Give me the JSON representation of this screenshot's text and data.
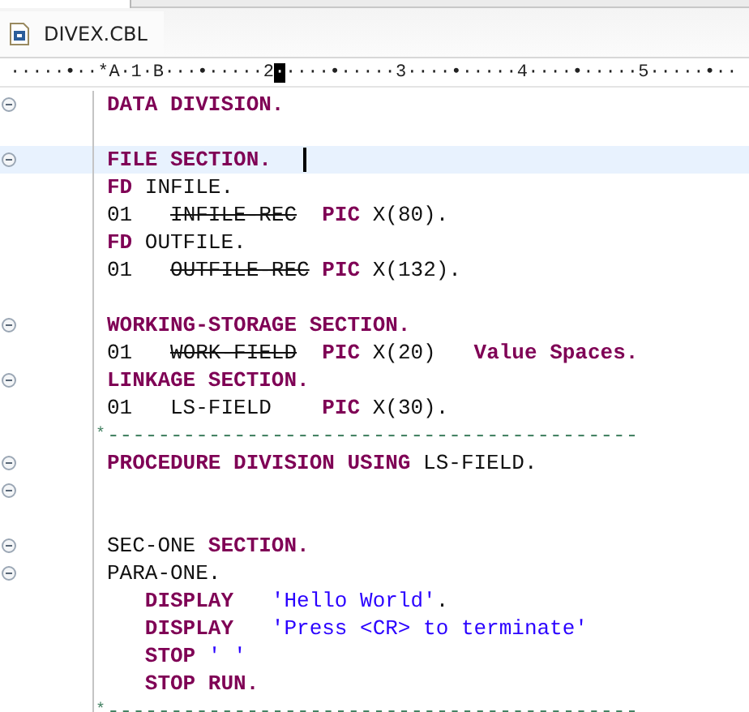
{
  "tab": {
    "title": "DIVEX.CBL"
  },
  "ruler": {
    "before": "·····•··*A·1·B···•·····2",
    "cursor": "·",
    "after": "····•·····3····•·····4····•·····5·····•··"
  },
  "lines": [
    {
      "kind": "code",
      "fold": true,
      "tokens": [
        {
          "kind": "keyword",
          "text": "DATA DIVISION."
        }
      ]
    },
    {
      "kind": "blank"
    },
    {
      "kind": "code",
      "fold": true,
      "current": true,
      "tokens": [
        {
          "kind": "keyword",
          "text": "FILE SECTION."
        }
      ]
    },
    {
      "kind": "code",
      "tokens": [
        {
          "kind": "keyword",
          "text": "FD "
        },
        {
          "kind": "plain",
          "text": "INFILE."
        }
      ]
    },
    {
      "kind": "code",
      "tokens": [
        {
          "kind": "plain",
          "text": "01   "
        },
        {
          "kind": "deleted",
          "text": "INFILE-REC"
        },
        {
          "kind": "keyword",
          "text": "  PIC "
        },
        {
          "kind": "plain",
          "text": "X(80)."
        }
      ]
    },
    {
      "kind": "code",
      "tokens": [
        {
          "kind": "keyword",
          "text": "FD "
        },
        {
          "kind": "plain",
          "text": "OUTFILE."
        }
      ]
    },
    {
      "kind": "code",
      "tokens": [
        {
          "kind": "plain",
          "text": "01   "
        },
        {
          "kind": "deleted",
          "text": "OUTFILE-REC"
        },
        {
          "kind": "keyword",
          "text": " PIC "
        },
        {
          "kind": "plain",
          "text": "X(132)."
        }
      ]
    },
    {
      "kind": "blank"
    },
    {
      "kind": "code",
      "fold": true,
      "tokens": [
        {
          "kind": "keyword",
          "text": "WORKING-STORAGE SECTION."
        }
      ]
    },
    {
      "kind": "code",
      "tokens": [
        {
          "kind": "plain",
          "text": "01   "
        },
        {
          "kind": "deleted",
          "text": "WORK-FIELD"
        },
        {
          "kind": "keyword",
          "text": "  PIC "
        },
        {
          "kind": "plain",
          "text": "X(20)   "
        },
        {
          "kind": "keyword",
          "text": "Value Spaces."
        }
      ]
    },
    {
      "kind": "code",
      "fold": true,
      "tokens": [
        {
          "kind": "keyword",
          "text": "LINKAGE SECTION."
        }
      ]
    },
    {
      "kind": "code",
      "tokens": [
        {
          "kind": "plain",
          "text": "01   LS-FIELD    "
        },
        {
          "kind": "keyword",
          "text": "PIC "
        },
        {
          "kind": "plain",
          "text": "X(30)."
        }
      ]
    },
    {
      "kind": "comment",
      "indicator": "*",
      "tokens": [
        {
          "kind": "comment",
          "text": "------------------------------------------"
        }
      ]
    },
    {
      "kind": "code",
      "fold": true,
      "tokens": [
        {
          "kind": "keyword",
          "text": "PROCEDURE DIVISION USING "
        },
        {
          "kind": "plain",
          "text": "LS-FIELD."
        }
      ]
    },
    {
      "kind": "blank",
      "fold": true
    },
    {
      "kind": "blank"
    },
    {
      "kind": "code",
      "fold": true,
      "tokens": [
        {
          "kind": "plain",
          "text": "SEC-ONE "
        },
        {
          "kind": "keyword",
          "text": "SECTION."
        }
      ]
    },
    {
      "kind": "code",
      "fold": true,
      "tokens": [
        {
          "kind": "plain",
          "text": "PARA-ONE."
        }
      ]
    },
    {
      "kind": "code",
      "tokens": [
        {
          "kind": "keyword",
          "text": "   DISPLAY   "
        },
        {
          "kind": "string",
          "text": "'Hello World'"
        },
        {
          "kind": "plain",
          "text": "."
        }
      ]
    },
    {
      "kind": "code",
      "tokens": [
        {
          "kind": "keyword",
          "text": "   DISPLAY   "
        },
        {
          "kind": "string",
          "text": "'Press <CR> to terminate'"
        }
      ]
    },
    {
      "kind": "code",
      "tokens": [
        {
          "kind": "keyword",
          "text": "   STOP "
        },
        {
          "kind": "string",
          "text": "' '"
        }
      ]
    },
    {
      "kind": "code",
      "tokens": [
        {
          "kind": "keyword",
          "text": "   STOP RUN."
        }
      ]
    },
    {
      "kind": "comment",
      "indicator": "*",
      "tokens": [
        {
          "kind": "comment",
          "text": "------------------------------------------"
        }
      ]
    }
  ]
}
